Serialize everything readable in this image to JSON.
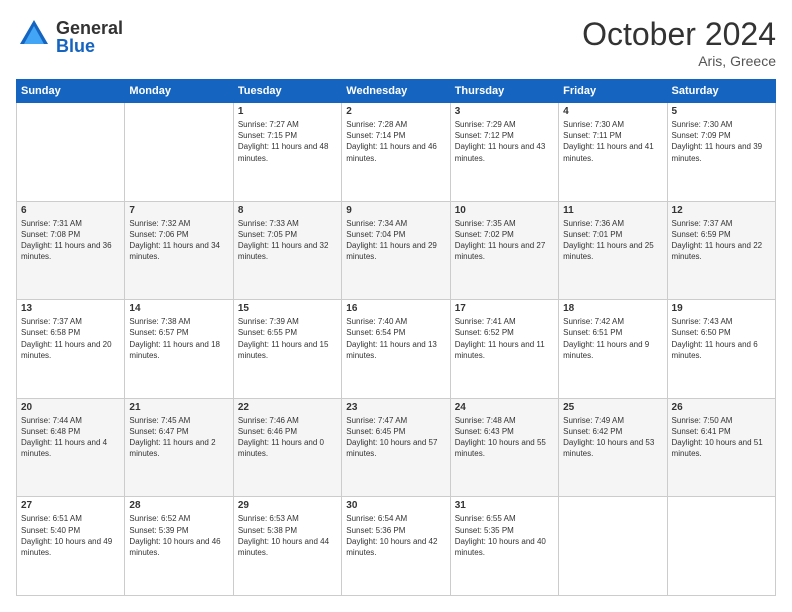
{
  "logo": {
    "general": "General",
    "blue": "Blue"
  },
  "header": {
    "month": "October 2024",
    "location": "Aris, Greece"
  },
  "weekdays": [
    "Sunday",
    "Monday",
    "Tuesday",
    "Wednesday",
    "Thursday",
    "Friday",
    "Saturday"
  ],
  "weeks": [
    [
      {
        "day": "",
        "content": ""
      },
      {
        "day": "",
        "content": ""
      },
      {
        "day": "1",
        "content": "Sunrise: 7:27 AM\nSunset: 7:15 PM\nDaylight: 11 hours and 48 minutes."
      },
      {
        "day": "2",
        "content": "Sunrise: 7:28 AM\nSunset: 7:14 PM\nDaylight: 11 hours and 46 minutes."
      },
      {
        "day": "3",
        "content": "Sunrise: 7:29 AM\nSunset: 7:12 PM\nDaylight: 11 hours and 43 minutes."
      },
      {
        "day": "4",
        "content": "Sunrise: 7:30 AM\nSunset: 7:11 PM\nDaylight: 11 hours and 41 minutes."
      },
      {
        "day": "5",
        "content": "Sunrise: 7:30 AM\nSunset: 7:09 PM\nDaylight: 11 hours and 39 minutes."
      }
    ],
    [
      {
        "day": "6",
        "content": "Sunrise: 7:31 AM\nSunset: 7:08 PM\nDaylight: 11 hours and 36 minutes."
      },
      {
        "day": "7",
        "content": "Sunrise: 7:32 AM\nSunset: 7:06 PM\nDaylight: 11 hours and 34 minutes."
      },
      {
        "day": "8",
        "content": "Sunrise: 7:33 AM\nSunset: 7:05 PM\nDaylight: 11 hours and 32 minutes."
      },
      {
        "day": "9",
        "content": "Sunrise: 7:34 AM\nSunset: 7:04 PM\nDaylight: 11 hours and 29 minutes."
      },
      {
        "day": "10",
        "content": "Sunrise: 7:35 AM\nSunset: 7:02 PM\nDaylight: 11 hours and 27 minutes."
      },
      {
        "day": "11",
        "content": "Sunrise: 7:36 AM\nSunset: 7:01 PM\nDaylight: 11 hours and 25 minutes."
      },
      {
        "day": "12",
        "content": "Sunrise: 7:37 AM\nSunset: 6:59 PM\nDaylight: 11 hours and 22 minutes."
      }
    ],
    [
      {
        "day": "13",
        "content": "Sunrise: 7:37 AM\nSunset: 6:58 PM\nDaylight: 11 hours and 20 minutes."
      },
      {
        "day": "14",
        "content": "Sunrise: 7:38 AM\nSunset: 6:57 PM\nDaylight: 11 hours and 18 minutes."
      },
      {
        "day": "15",
        "content": "Sunrise: 7:39 AM\nSunset: 6:55 PM\nDaylight: 11 hours and 15 minutes."
      },
      {
        "day": "16",
        "content": "Sunrise: 7:40 AM\nSunset: 6:54 PM\nDaylight: 11 hours and 13 minutes."
      },
      {
        "day": "17",
        "content": "Sunrise: 7:41 AM\nSunset: 6:52 PM\nDaylight: 11 hours and 11 minutes."
      },
      {
        "day": "18",
        "content": "Sunrise: 7:42 AM\nSunset: 6:51 PM\nDaylight: 11 hours and 9 minutes."
      },
      {
        "day": "19",
        "content": "Sunrise: 7:43 AM\nSunset: 6:50 PM\nDaylight: 11 hours and 6 minutes."
      }
    ],
    [
      {
        "day": "20",
        "content": "Sunrise: 7:44 AM\nSunset: 6:48 PM\nDaylight: 11 hours and 4 minutes."
      },
      {
        "day": "21",
        "content": "Sunrise: 7:45 AM\nSunset: 6:47 PM\nDaylight: 11 hours and 2 minutes."
      },
      {
        "day": "22",
        "content": "Sunrise: 7:46 AM\nSunset: 6:46 PM\nDaylight: 11 hours and 0 minutes."
      },
      {
        "day": "23",
        "content": "Sunrise: 7:47 AM\nSunset: 6:45 PM\nDaylight: 10 hours and 57 minutes."
      },
      {
        "day": "24",
        "content": "Sunrise: 7:48 AM\nSunset: 6:43 PM\nDaylight: 10 hours and 55 minutes."
      },
      {
        "day": "25",
        "content": "Sunrise: 7:49 AM\nSunset: 6:42 PM\nDaylight: 10 hours and 53 minutes."
      },
      {
        "day": "26",
        "content": "Sunrise: 7:50 AM\nSunset: 6:41 PM\nDaylight: 10 hours and 51 minutes."
      }
    ],
    [
      {
        "day": "27",
        "content": "Sunrise: 6:51 AM\nSunset: 5:40 PM\nDaylight: 10 hours and 49 minutes."
      },
      {
        "day": "28",
        "content": "Sunrise: 6:52 AM\nSunset: 5:39 PM\nDaylight: 10 hours and 46 minutes."
      },
      {
        "day": "29",
        "content": "Sunrise: 6:53 AM\nSunset: 5:38 PM\nDaylight: 10 hours and 44 minutes."
      },
      {
        "day": "30",
        "content": "Sunrise: 6:54 AM\nSunset: 5:36 PM\nDaylight: 10 hours and 42 minutes."
      },
      {
        "day": "31",
        "content": "Sunrise: 6:55 AM\nSunset: 5:35 PM\nDaylight: 10 hours and 40 minutes."
      },
      {
        "day": "",
        "content": ""
      },
      {
        "day": "",
        "content": ""
      }
    ]
  ]
}
